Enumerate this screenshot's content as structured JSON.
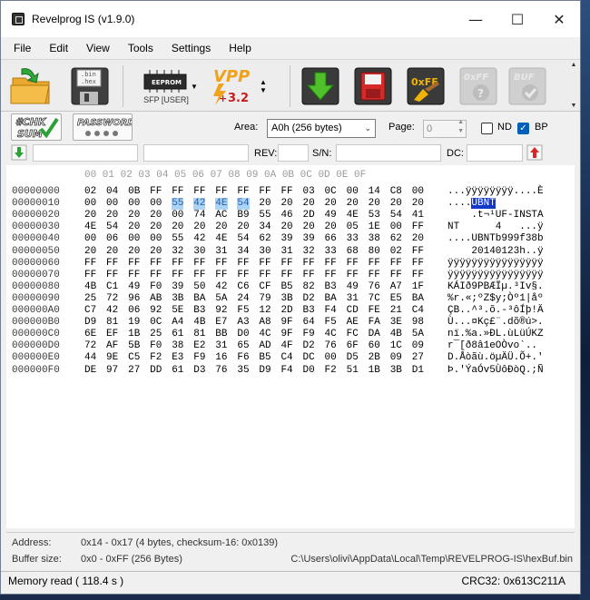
{
  "window": {
    "title": "Revelprog IS (v1.9.0)"
  },
  "menu": [
    "File",
    "Edit",
    "View",
    "Tools",
    "Settings",
    "Help"
  ],
  "toolbar": {
    "open_file_text": ".bin\n.hex",
    "save_file_text": ".bin\n.hex",
    "chip_label": "EEPROM",
    "chip_caption": "SFP [USER]",
    "vpp_label": "VPP",
    "vpp_value": "3.2",
    "fill_label": "0xFF",
    "fill_disabled_label": "0xFF",
    "buf_label": "BUF"
  },
  "controls": {
    "checksum_label": "#CHK\nSUM",
    "password_label": "PASSWORD",
    "password_mask": "✱ ✱ ✱ ✱",
    "area_label": "Area:",
    "area_value": "A0h (256 bytes)",
    "page_label": "Page:",
    "page_value": "0",
    "nd_label": "ND",
    "bp_label": "BP",
    "rev_label": "REV:",
    "sn_label": "S/N:",
    "dc_label": "DC:"
  },
  "hex": {
    "header": "00 01 02 03 04 05 06 07 08 09 0A 0B 0C 0D 0E 0F",
    "rows": [
      {
        "addr": "00000000",
        "bytes": [
          "02",
          "04",
          "0B",
          "FF",
          "FF",
          "FF",
          "FF",
          "FF",
          "FF",
          "FF",
          "03",
          "0C",
          "00",
          "14",
          "C8",
          "00"
        ],
        "ascii_a": "...",
        "ascii_b": "ÿÿÿÿÿÿÿÿ",
        "ascii_c": "....È"
      },
      {
        "addr": "00000010",
        "bytes": [
          "00",
          "00",
          "00",
          "00",
          "55",
          "42",
          "4E",
          "54",
          "20",
          "20",
          "20",
          "20",
          "20",
          "20",
          "20",
          "20"
        ],
        "ascii_a": "....",
        "ascii_b": "UBNT",
        "ascii_c": ""
      },
      {
        "addr": "00000020",
        "bytes": [
          "20",
          "20",
          "20",
          "20",
          "00",
          "74",
          "AC",
          "B9",
          "55",
          "46",
          "2D",
          "49",
          "4E",
          "53",
          "54",
          "41"
        ],
        "ascii_a": "    .t¬¹UF-INSTA",
        "ascii_b": "",
        "ascii_c": ""
      },
      {
        "addr": "00000030",
        "bytes": [
          "4E",
          "54",
          "20",
          "20",
          "20",
          "20",
          "20",
          "20",
          "34",
          "20",
          "20",
          "20",
          "05",
          "1E",
          "00",
          "FF"
        ],
        "ascii_a": "NT      4   ...ÿ",
        "ascii_b": "",
        "ascii_c": ""
      },
      {
        "addr": "00000040",
        "bytes": [
          "00",
          "06",
          "00",
          "00",
          "55",
          "42",
          "4E",
          "54",
          "62",
          "39",
          "39",
          "66",
          "33",
          "38",
          "62",
          "20"
        ],
        "ascii_a": "....UBNTb999f38b ",
        "ascii_b": "",
        "ascii_c": ""
      },
      {
        "addr": "00000050",
        "bytes": [
          "20",
          "20",
          "20",
          "20",
          "32",
          "30",
          "31",
          "34",
          "30",
          "31",
          "32",
          "33",
          "68",
          "80",
          "02",
          "FF"
        ],
        "ascii_a": "    20140123h..ÿ",
        "ascii_b": "",
        "ascii_c": ""
      },
      {
        "addr": "00000060",
        "bytes": [
          "FF",
          "FF",
          "FF",
          "FF",
          "FF",
          "FF",
          "FF",
          "FF",
          "FF",
          "FF",
          "FF",
          "FF",
          "FF",
          "FF",
          "FF",
          "FF"
        ],
        "ascii_a": "ÿÿÿÿÿÿÿÿÿÿÿÿÿÿÿÿ",
        "ascii_b": "",
        "ascii_c": ""
      },
      {
        "addr": "00000070",
        "bytes": [
          "FF",
          "FF",
          "FF",
          "FF",
          "FF",
          "FF",
          "FF",
          "FF",
          "FF",
          "FF",
          "FF",
          "FF",
          "FF",
          "FF",
          "FF",
          "FF"
        ],
        "ascii_a": "ÿÿÿÿÿÿÿÿÿÿÿÿÿÿÿÿ",
        "ascii_b": "",
        "ascii_c": ""
      },
      {
        "addr": "00000080",
        "bytes": [
          "4B",
          "C1",
          "49",
          "F0",
          "39",
          "50",
          "42",
          "C6",
          "CF",
          "B5",
          "82",
          "B3",
          "49",
          "76",
          "A7",
          "1F"
        ],
        "ascii_a": "KÁIð9PBÆÏµ.³Iv§.",
        "ascii_b": "",
        "ascii_c": ""
      },
      {
        "addr": "00000090",
        "bytes": [
          "25",
          "72",
          "96",
          "AB",
          "3B",
          "BA",
          "5A",
          "24",
          "79",
          "3B",
          "D2",
          "BA",
          "31",
          "7C",
          "E5",
          "BA"
        ],
        "ascii_a": "%r.«;ºZ$y;Òº1|åº",
        "ascii_b": "",
        "ascii_c": ""
      },
      {
        "addr": "000000A0",
        "bytes": [
          "C7",
          "42",
          "06",
          "92",
          "5E",
          "B3",
          "92",
          "F5",
          "12",
          "2D",
          "B3",
          "F4",
          "CD",
          "FE",
          "21",
          "C4"
        ],
        "ascii_a": "ÇB..^³.õ.-³ôÍþ!Ä",
        "ascii_b": "",
        "ascii_c": ""
      },
      {
        "addr": "000000B0",
        "bytes": [
          "D9",
          "81",
          "19",
          "0C",
          "A4",
          "4B",
          "E7",
          "A3",
          "A8",
          "9F",
          "64",
          "F5",
          "AE",
          "FA",
          "3E",
          "98"
        ],
        "ascii_a": "Ù...¤Kç£¨.dõ®ú>.",
        "ascii_b": "",
        "ascii_c": ""
      },
      {
        "addr": "000000C0",
        "bytes": [
          "6E",
          "EF",
          "1B",
          "25",
          "61",
          "81",
          "BB",
          "D0",
          "4C",
          "9F",
          "F9",
          "4C",
          "FC",
          "DA",
          "4B",
          "5A"
        ],
        "ascii_a": "nï.%a.»ÐL.ùLüÚKZ",
        "ascii_b": "",
        "ascii_c": ""
      },
      {
        "addr": "000000D0",
        "bytes": [
          "72",
          "AF",
          "5B",
          "F0",
          "38",
          "E2",
          "31",
          "65",
          "AD",
          "4F",
          "D2",
          "76",
          "6F",
          "60",
          "1C",
          "09"
        ],
        "ascii_a": "r¯[ð8â1e­OÒvo`..",
        "ascii_b": "",
        "ascii_c": ""
      },
      {
        "addr": "000000E0",
        "bytes": [
          "44",
          "9E",
          "C5",
          "F2",
          "E3",
          "F9",
          "16",
          "F6",
          "B5",
          "C4",
          "DC",
          "00",
          "D5",
          "2B",
          "09",
          "27"
        ],
        "ascii_a": "D.Åòãù.öµÄÜ.Õ+.'",
        "ascii_b": "",
        "ascii_c": ""
      },
      {
        "addr": "000000F0",
        "bytes": [
          "DE",
          "97",
          "27",
          "DD",
          "61",
          "D3",
          "76",
          "35",
          "D9",
          "F4",
          "D0",
          "F2",
          "51",
          "1B",
          "3B",
          "D1"
        ],
        "ascii_a": "Þ.'ÝaÓv5ÙôÐòQ.;Ñ",
        "ascii_b": "",
        "ascii_c": ""
      }
    ]
  },
  "status_panel": {
    "address_label": "Address:",
    "address_value": "0x14 - 0x17 (4 bytes, checksum-16: 0x0139)",
    "buffer_label": "Buffer size:",
    "buffer_value": "0x0 - 0xFF (256 Bytes)",
    "buffer_path": "C:\\Users\\olivi\\AppData\\Local\\Temp\\REVELPROG-IS\\hexBuf.bin"
  },
  "statusbar": {
    "left": "Memory read ( 118.4 s )",
    "right": "CRC32: 0x613C211A"
  }
}
